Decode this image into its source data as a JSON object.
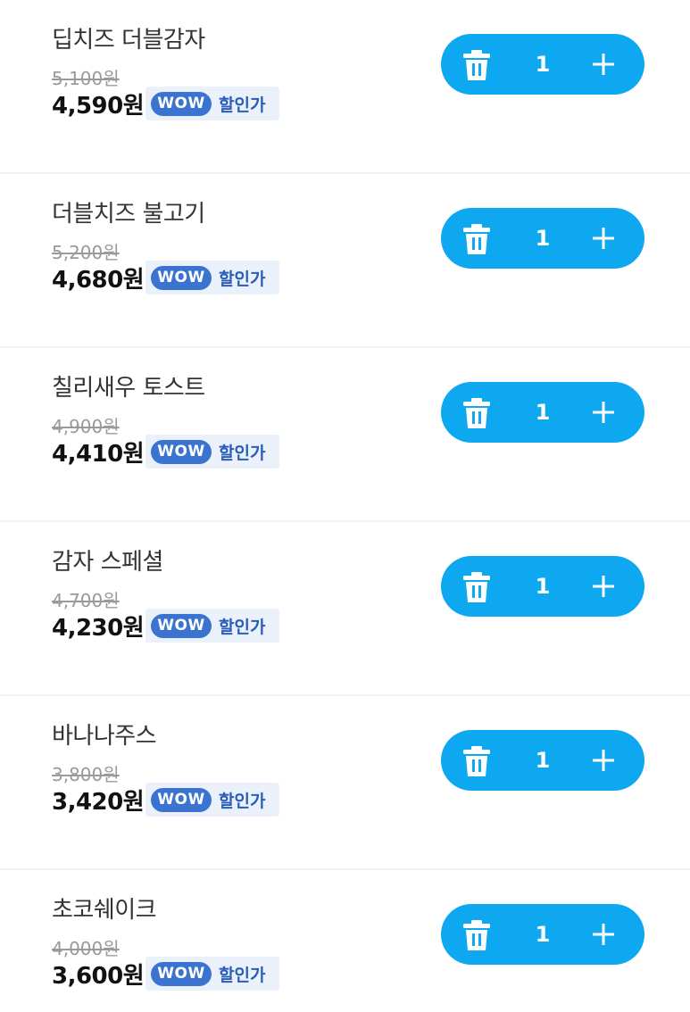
{
  "cart": {
    "items": [
      {
        "name": "딥치즈 더블감자",
        "original_price": "5,100원",
        "price": "4,590원",
        "badge": "WOW",
        "discount_label": "할인가",
        "quantity": "1"
      },
      {
        "name": "더블치즈 불고기",
        "original_price": "5,200원",
        "price": "4,680원",
        "badge": "WOW",
        "discount_label": "할인가",
        "quantity": "1"
      },
      {
        "name": "칠리새우 토스트",
        "original_price": "4,900원",
        "price": "4,410원",
        "badge": "WOW",
        "discount_label": "할인가",
        "quantity": "1"
      },
      {
        "name": "감자 스페셜",
        "original_price": "4,700원",
        "price": "4,230원",
        "badge": "WOW",
        "discount_label": "할인가",
        "quantity": "1"
      },
      {
        "name": "바나나주스",
        "original_price": "3,800원",
        "price": "3,420원",
        "badge": "WOW",
        "discount_label": "할인가",
        "quantity": "1"
      },
      {
        "name": "초코쉐이크",
        "original_price": "4,000원",
        "price": "3,600원",
        "badge": "WOW",
        "discount_label": "할인가",
        "quantity": "1"
      }
    ]
  },
  "icons": {
    "remove": "trash-icon",
    "increase": "plus-icon"
  },
  "colors": {
    "stepper_bg": "#0da8f0",
    "wow_badge": "#3b73d0",
    "discount_text": "#2a5db8",
    "badge_bg": "#eaf1fb"
  }
}
